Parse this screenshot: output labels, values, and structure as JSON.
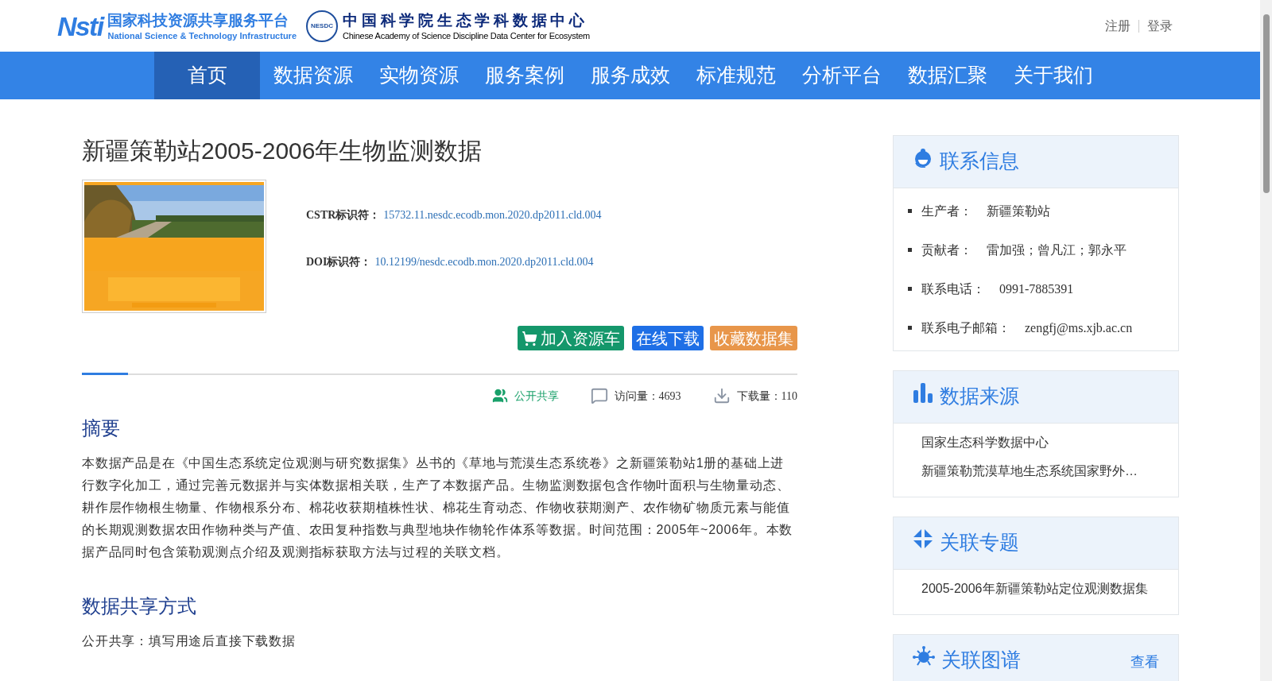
{
  "header": {
    "logo_mark": "Nsti",
    "platform_title": "国家科技资源共享服务平台",
    "platform_subtitle": "National Science & Technology Infrastructure",
    "center_badge": "NESDC",
    "center_title": "中国科学院生态学科数据中心",
    "center_subtitle": "Chinese Academy of Science Discipline Data Center for Ecosystem",
    "links": [
      "注册",
      "登录"
    ]
  },
  "nav": [
    {
      "label": "首页",
      "selected": true
    },
    {
      "label": "数据资源",
      "selected": false
    },
    {
      "label": "实物资源",
      "selected": false
    },
    {
      "label": "服务案例",
      "selected": false
    },
    {
      "label": "服务成效",
      "selected": false
    },
    {
      "label": "标准规范",
      "selected": false
    },
    {
      "label": "分析平台",
      "selected": false
    },
    {
      "label": "数据汇聚",
      "selected": false
    },
    {
      "label": "关于我们",
      "selected": false
    }
  ],
  "dataset": {
    "title": "新疆策勒站2005-2006年生物监测数据",
    "identifiers": [
      {
        "label": "CSTR标识符：",
        "value": "15732.11.nesdc.ecodb.mon.2020.dp2011.cld.004"
      },
      {
        "label": "DOI标识符：",
        "value": "10.12199/nesdc.ecodb.mon.2020.dp2011.cld.004"
      }
    ],
    "actions": [
      {
        "kind": "cart",
        "label": "加入资源车"
      },
      {
        "kind": "download",
        "label": "在线下载"
      },
      {
        "kind": "favorite",
        "label": "收藏数据集"
      }
    ],
    "stats": [
      {
        "kind": "share",
        "text": "公开共享"
      },
      {
        "kind": "visits",
        "text": "访问量：4693"
      },
      {
        "kind": "downloads",
        "text": "下载量：110"
      }
    ],
    "sections": [
      {
        "heading": "摘要",
        "body": "本数据产品是在《中国生态系统定位观测与研究数据集》丛书的《草地与荒漠生态系统卷》之新疆策勒站1册的基础上进行数字化加工，通过完善元数据并与实体数据相关联，生产了本数据产品。生物监测数据包含作物叶面积与生物量动态、耕作层作物根生物量、作物根系分布、棉花收获期植株性状、棉花生育动态、作物收获期测产、农作物矿物质元素与能值的长期观测数据农田作物种类与产值、农田复种指数与典型地块作物轮作体系等数据。时间范围：2005年~2006年。本数据产品同时包含策勒观测点介绍及观测指标获取方法与过程的关联文档。"
      },
      {
        "heading": "数据共享方式",
        "body": "公开共享：填写用途后直接下载数据"
      }
    ]
  },
  "sidebar": [
    {
      "kind": "contact",
      "title": "联系信息",
      "items": [
        {
          "label": "生产者：",
          "value": "新疆策勒站"
        },
        {
          "label": "贡献者：",
          "value": "雷加强；曾凡江；郭永平"
        },
        {
          "label": "联系电话：",
          "value": "0991-7885391"
        },
        {
          "label": "联系电子邮箱：",
          "value": "zengfj@ms.xjb.ac.cn"
        }
      ]
    },
    {
      "kind": "source",
      "title": "数据来源",
      "items": [
        {
          "value": "国家生态科学数据中心"
        },
        {
          "value": "新疆策勒荒漠草地生态系统国家野外…"
        }
      ]
    },
    {
      "kind": "topic",
      "title": "关联专题",
      "items": [
        {
          "value": "2005-2006年新疆策勒站定位观测数据集"
        }
      ]
    },
    {
      "kind": "graph",
      "title": "关联图谱",
      "more": "查看"
    }
  ]
}
